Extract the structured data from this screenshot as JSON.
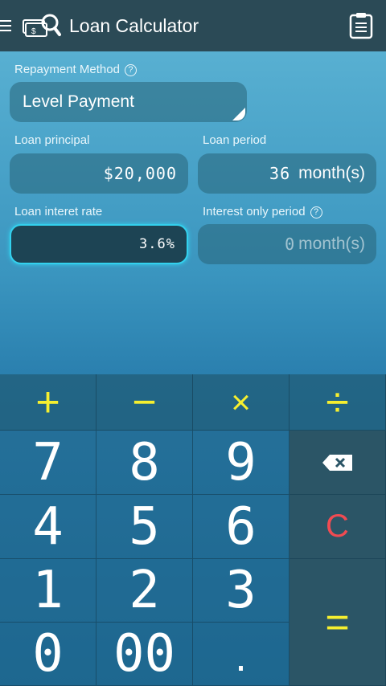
{
  "header": {
    "title": "Loan Calculator"
  },
  "repayment": {
    "label": "Repayment Method",
    "help": "?",
    "value": "Level Payment"
  },
  "principal": {
    "label": "Loan principal",
    "value": "$20,000"
  },
  "period": {
    "label": "Loan period",
    "value": "36",
    "unit": "month(s)"
  },
  "rate": {
    "label": "Loan interet rate",
    "value": "3.6%"
  },
  "interest_only": {
    "label": "Interest only period",
    "help": "?",
    "value": "0",
    "unit": "month(s)"
  },
  "keys": {
    "plus": "+",
    "minus": "−",
    "times": "×",
    "divide": "÷",
    "k7": "7",
    "k8": "8",
    "k9": "9",
    "k4": "4",
    "k5": "5",
    "k6": "6",
    "k1": "1",
    "k2": "2",
    "k3": "3",
    "k0": "0",
    "k00": "00",
    "dot": ".",
    "clear": "C",
    "equals": "="
  },
  "colors": {
    "header": "#2b4a56",
    "operator": "#f6ef2f",
    "clear": "#f04b52",
    "active_border": "#33d1ee"
  }
}
